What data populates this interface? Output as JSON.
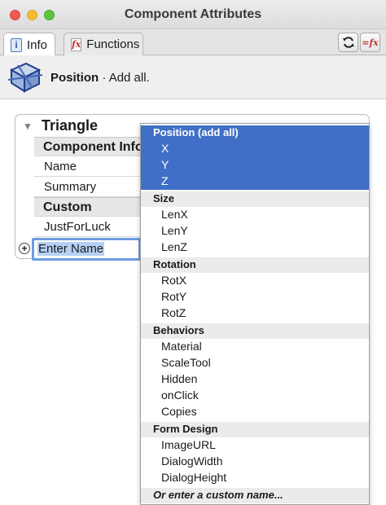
{
  "window": {
    "title": "Component Attributes"
  },
  "tabs": [
    {
      "label": "Info",
      "icon": "info-icon",
      "active": true
    },
    {
      "label": "Functions",
      "icon": "fx-icon",
      "active": false
    }
  ],
  "toolbar": {
    "refresh_icon": "refresh-icon",
    "add_function_icon": "add-function-icon",
    "fx_glyph": "=fx"
  },
  "header": {
    "attribute": "Position",
    "separator": " · ",
    "description": "Add all."
  },
  "component": {
    "name": "Triangle",
    "sections": [
      {
        "title": "Component Info",
        "rows": [
          "Name",
          "Summary"
        ]
      },
      {
        "title": "Custom",
        "rows": [
          "JustForLuck"
        ]
      }
    ],
    "new_name_value": "Enter Name"
  },
  "dropdown": {
    "groups": [
      {
        "title": "Position (add all)",
        "selected": true,
        "items": [
          {
            "label": "X",
            "selected": true
          },
          {
            "label": "Y",
            "selected": true
          },
          {
            "label": "Z",
            "selected": true
          }
        ]
      },
      {
        "title": "Size",
        "selected": false,
        "items": [
          {
            "label": "LenX"
          },
          {
            "label": "LenY"
          },
          {
            "label": "LenZ"
          }
        ]
      },
      {
        "title": "Rotation",
        "selected": false,
        "items": [
          {
            "label": "RotX"
          },
          {
            "label": "RotY"
          },
          {
            "label": "RotZ"
          }
        ]
      },
      {
        "title": "Behaviors",
        "selected": false,
        "items": [
          {
            "label": "Material"
          },
          {
            "label": "ScaleTool"
          },
          {
            "label": "Hidden"
          },
          {
            "label": "onClick"
          },
          {
            "label": "Copies"
          }
        ]
      },
      {
        "title": "Form Design",
        "selected": false,
        "items": [
          {
            "label": "ImageURL"
          },
          {
            "label": "DialogWidth"
          },
          {
            "label": "DialogHeight"
          }
        ]
      }
    ],
    "custom_prompt": "Or enter a custom name..."
  },
  "colors": {
    "selection": "#3f6fc6",
    "section_bg": "#ebebeb",
    "input_focus": "#6c9be0"
  }
}
